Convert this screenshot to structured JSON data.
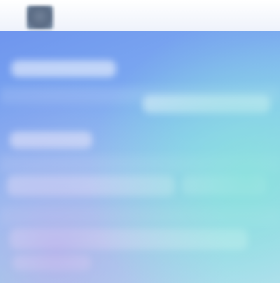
{
  "topbar": {
    "avatar_icon": "avatar-icon"
  },
  "content": {
    "lines": [
      {
        "text": ""
      },
      {
        "text": ""
      },
      {
        "text": ""
      },
      {
        "text": ""
      },
      {
        "text": ""
      },
      {
        "text": ""
      },
      {
        "text": ""
      }
    ]
  },
  "colors": {
    "topbar": "#f3f5fb",
    "gradient_start": "#6f95ee",
    "gradient_mid": "#89c7f1",
    "gradient_end": "#b9dff1",
    "accent_teal": "#8ae2dc",
    "accent_purple": "#bcaaeb"
  }
}
